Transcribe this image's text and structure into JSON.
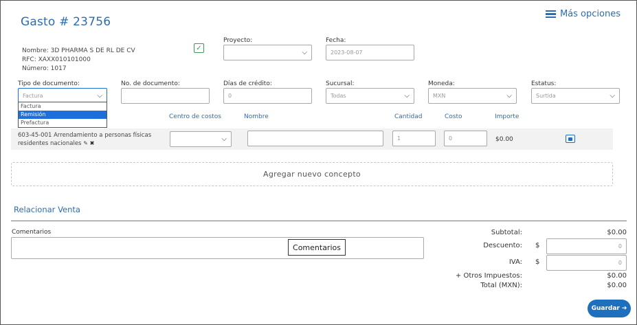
{
  "header": {
    "title": "Gasto # 23756",
    "more_options": "Más opciones"
  },
  "provider": {
    "nombre": "Nombre: 3D PHARMA S DE RL DE CV",
    "rfc": "RFC: XAXX010101000",
    "numero": "Número: 1017"
  },
  "fields": {
    "proyecto_label": "Proyecto:",
    "fecha_label": "Fecha:",
    "fecha_value": "2023-08-07",
    "tipo_label": "Tipo de documento:",
    "tipo_value": "Factura",
    "nodoc_label": "No. de documento:",
    "dias_label": "Días de crédito:",
    "dias_value": "0",
    "sucursal_label": "Sucursal:",
    "sucursal_value": "Todas",
    "moneda_label": "Moneda:",
    "moneda_value": "MXN",
    "estatus_label": "Estatus:",
    "estatus_value": "Surtida"
  },
  "dropdown_options": [
    "Factura",
    "Remisión",
    "Prefactura"
  ],
  "table": {
    "headers": {
      "centro": "Centro de costos",
      "nombre": "Nombre",
      "cantidad": "Cantidad",
      "costo": "Costo",
      "importe": "Importe"
    },
    "row": {
      "concepto_line1": "603-45-001 Arrendamiento a personas físicas",
      "concepto_line2": "residentes nacionales",
      "cantidad": "1",
      "costo": "0",
      "importe": "$0.00"
    }
  },
  "add_concept": "Agregar nuevo concepto",
  "relacionar_venta": "Relacionar Venta",
  "comentarios": {
    "label": "Comentarios",
    "tooltip": "Comentarios"
  },
  "totals": {
    "subtotal_label": "Subtotal:",
    "subtotal_value": "$0.00",
    "descuento_label": "Descuento:",
    "descuento_currency": "$",
    "descuento_value": "0",
    "iva_label": "IVA:",
    "iva_currency": "$",
    "iva_value": "0",
    "otros_label": "+ Otros Impuestos:",
    "otros_value": "$0.00",
    "total_label": "Total (MXN):",
    "total_value": "$0.00"
  },
  "save_button": "Guardar"
}
